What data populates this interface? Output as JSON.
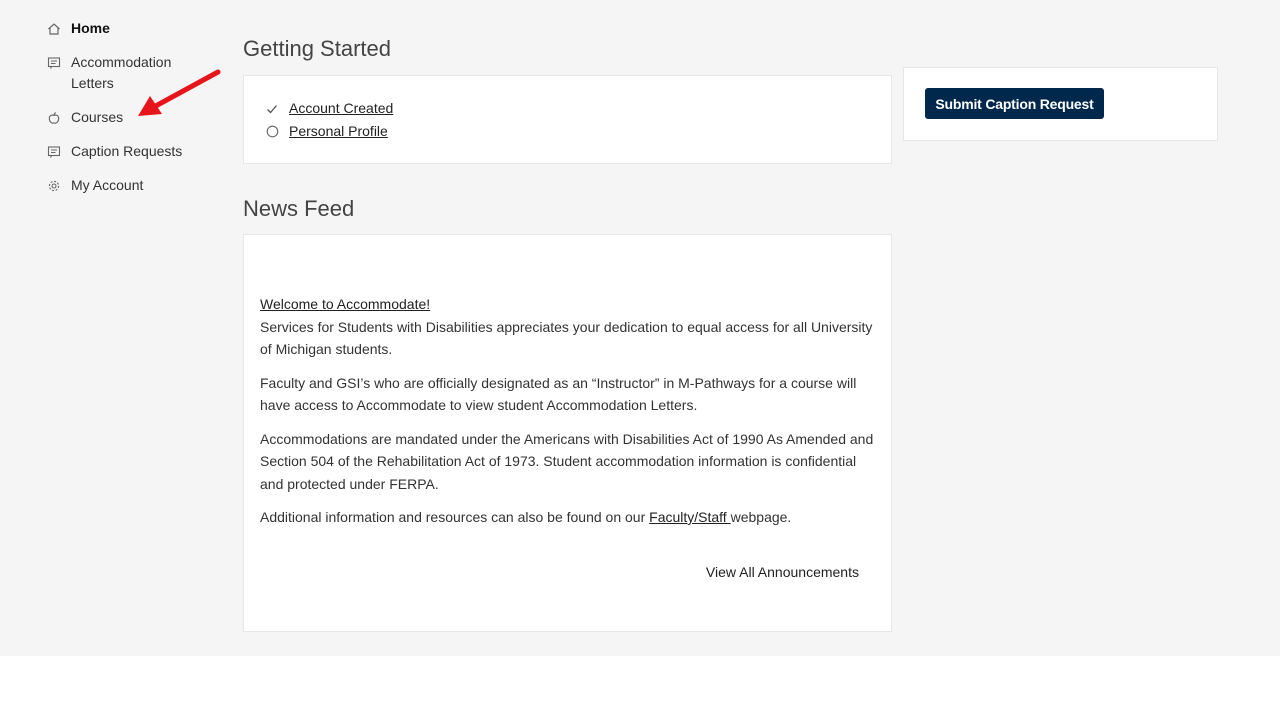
{
  "sidebar": {
    "items": [
      {
        "label": "Home",
        "icon": "home-icon"
      },
      {
        "label": "Accommodation Letters",
        "icon": "message-icon"
      },
      {
        "label": "Courses",
        "icon": "apple-icon"
      },
      {
        "label": "Caption Requests",
        "icon": "message-icon"
      },
      {
        "label": "My Account",
        "icon": "gear-icon"
      }
    ]
  },
  "getting_started": {
    "title": "Getting Started",
    "items": [
      {
        "label": "Account Created",
        "status": "complete"
      },
      {
        "label": "Personal Profile",
        "status": "incomplete"
      }
    ]
  },
  "caption": {
    "button_label": "Submit Caption Request"
  },
  "news_feed": {
    "title": "News Feed",
    "welcome_link": "Welcome to Accommodate!",
    "p1": "Services for Students with Disabilities appreciates your dedication to equal access for all University of Michigan students.",
    "p2": "Faculty and GSI’s who are officially designated as an “Instructor” in M-Pathways for a course will have access to Accommodate to view student Accommodation Letters.",
    "p3": "Accommodations are mandated under the Americans with Disabilities Act of 1990 As Amended and Section 504 of the Rehabilitation Act of 1973. Student accommodation information is confidential and protected under FERPA.",
    "p4_before": "Additional information and resources can also be found on our ",
    "p4_link": "Faculty/Staff ",
    "p4_after": "webpage.",
    "view_all": "View All Announcements"
  },
  "colors": {
    "page_bg": "#f5f5f5",
    "card_bg": "#ffffff",
    "primary_button": "#00274c",
    "annotation_arrow": "#e8141b"
  }
}
